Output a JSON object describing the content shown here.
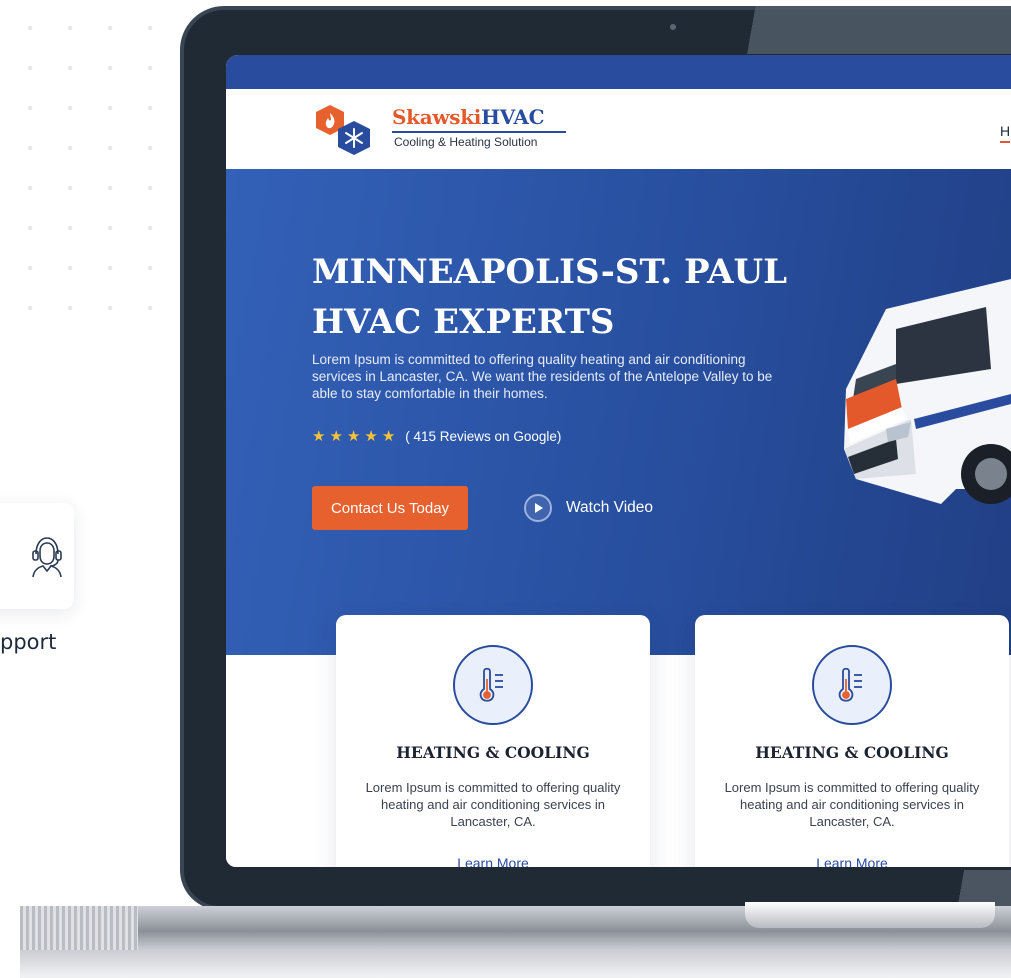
{
  "side": {
    "support_label": "pport"
  },
  "site": {
    "logo": {
      "name_part1": "Skawski",
      "name_part2": "HVAC",
      "tagline": "Cooling & Heating Solution"
    },
    "nav": {
      "first_link": "H"
    },
    "hero": {
      "title": "MINNEAPOLIS-ST. PAUL HVAC EXPERTS",
      "description": "Lorem Ipsum is committed to offering quality heating and air conditioning services in Lancaster, CA. We want the residents of the Antelope Valley to be able to stay comfortable in their homes.",
      "rating": {
        "stars": 5,
        "text": "( 415 Reviews on Google)"
      },
      "contact_button": "Contact Us Today",
      "video_button": "Watch Video"
    },
    "services": [
      {
        "title": "HEATING & COOLING",
        "description": "Lorem Ipsum is committed to offering quality heating and air conditioning services in Lancaster, CA.",
        "link": "Learn More"
      },
      {
        "title": "HEATING & COOLING",
        "description": "Lorem Ipsum is committed to offering quality heating and air conditioning services in Lancaster, CA.",
        "link": "Learn More"
      }
    ]
  },
  "colors": {
    "brand_blue": "#2a4c9e",
    "accent_orange": "#e7612f",
    "star_yellow": "#f6c23a",
    "bezel": "#1f2a35"
  },
  "icons": {
    "support": "headset-support-icon",
    "service": "thermometer-icon",
    "play": "play-icon",
    "star": "star-icon",
    "logo": "flame-snowflake-logo-icon"
  }
}
